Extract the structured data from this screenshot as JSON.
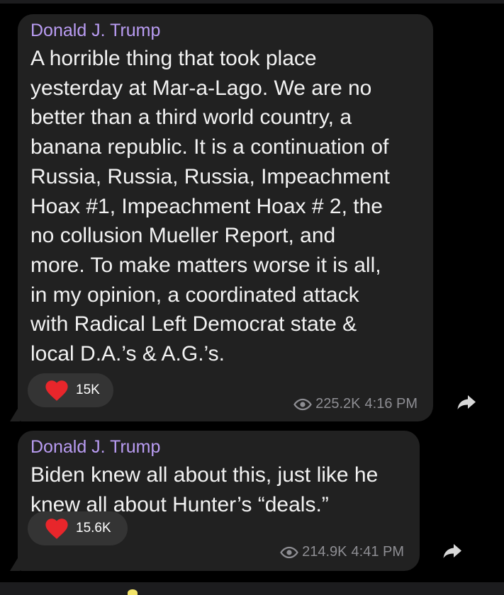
{
  "messages": [
    {
      "sender": "Donald J. Trump",
      "text": "A horrible thing that took place\nyesterday at Mar-a-Lago. We are no\nbetter than a third world country, a\nbanana republic. It is a continuation of\nRussia, Russia, Russia, Impeachment\nHoax #1, Impeachment Hoax # 2, the\nno collusion Mueller Report, and\nmore. To make matters worse it is all,\nin my opinion, a coordinated attack\nwith Radical Left Democrat state &\nlocal D.A.’s & A.G.’s.",
      "reaction_icon": "heart-icon",
      "reaction_count": "15K",
      "views": "225.2K",
      "time": "4:16 PM"
    },
    {
      "sender": "Donald J. Trump",
      "text": "Biden knew all about this, just like he\nknew all about Hunter’s “deals.”",
      "reaction_icon": "heart-icon",
      "reaction_count": "15.6K",
      "views": "214.9K",
      "time": "4:41 PM"
    }
  ],
  "colors": {
    "background": "#000000",
    "bubble": "#212121",
    "sender": "#b99cf2",
    "reaction_pill": "#343434",
    "heart": "#e8262b",
    "meta": "#8e8e93"
  }
}
